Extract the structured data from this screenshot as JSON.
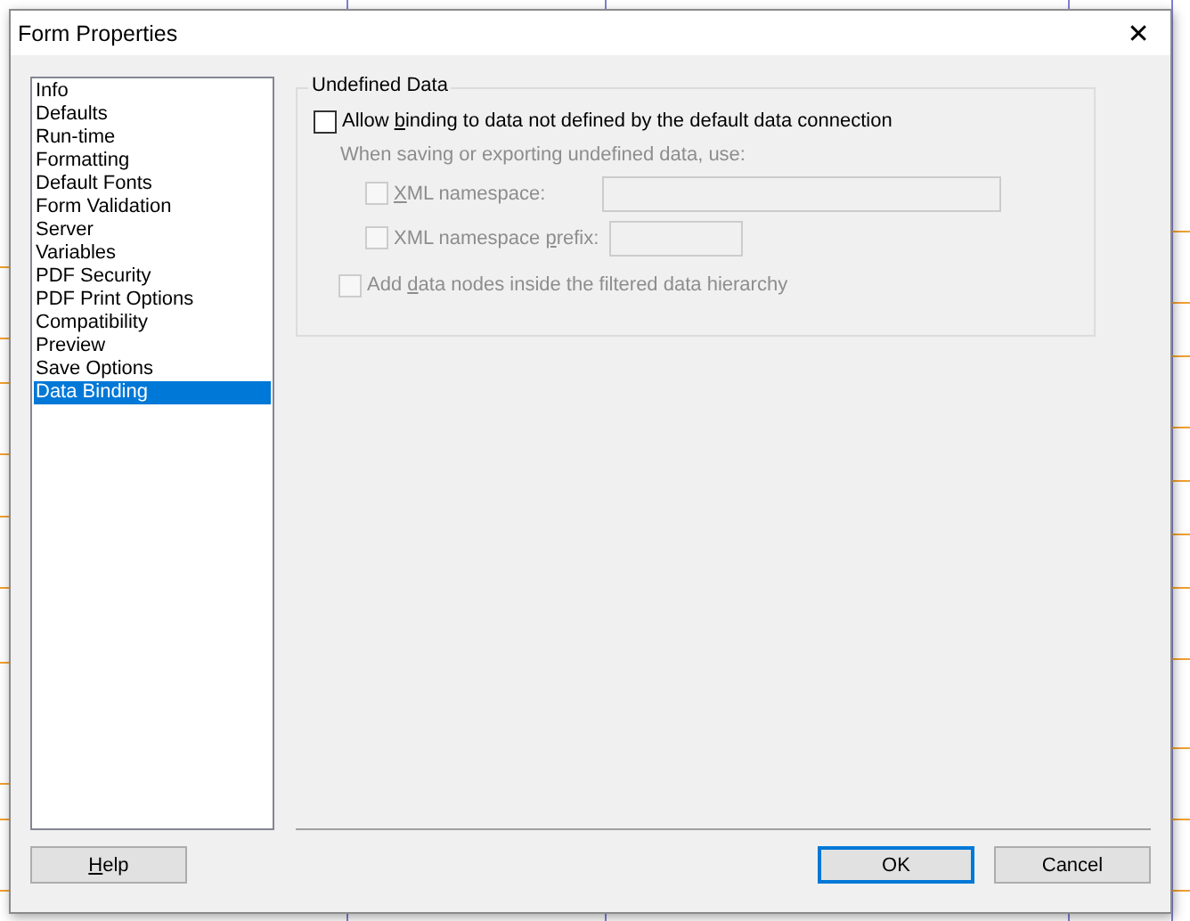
{
  "window": {
    "title": "Form Properties",
    "close": "✕"
  },
  "sidebar": {
    "items": [
      {
        "label": "Info",
        "selected": false
      },
      {
        "label": "Defaults",
        "selected": false
      },
      {
        "label": "Run-time",
        "selected": false
      },
      {
        "label": "Formatting",
        "selected": false
      },
      {
        "label": "Default Fonts",
        "selected": false
      },
      {
        "label": "Form Validation",
        "selected": false
      },
      {
        "label": "Server",
        "selected": false
      },
      {
        "label": "Variables",
        "selected": false
      },
      {
        "label": "PDF Security",
        "selected": false
      },
      {
        "label": "PDF Print Options",
        "selected": false
      },
      {
        "label": "Compatibility",
        "selected": false
      },
      {
        "label": "Preview",
        "selected": false
      },
      {
        "label": "Save Options",
        "selected": false
      },
      {
        "label": "Data Binding",
        "selected": true
      }
    ]
  },
  "group": {
    "title": "Undefined Data",
    "items": [
      {
        "kind": "option",
        "before": "Allow ",
        "key": "b",
        "after": "inding to data not defined by the default data connection",
        "checked": false,
        "disabled": false
      },
      {
        "kind": "note",
        "text": "When saving or exporting undefined data, use:",
        "disabled": true
      },
      {
        "kind": "widefield",
        "key": "X",
        "after": "ML namespace:",
        "checked": false,
        "disabled": true
      },
      {
        "kind": "shortfield",
        "before": "XML namespace ",
        "key": "p",
        "after": "refix:",
        "checked": false,
        "disabled": true
      },
      {
        "kind": "suboption",
        "before": "Add ",
        "key": "d",
        "after": "ata nodes inside the filtered data hierarchy",
        "checked": false,
        "disabled": true
      }
    ]
  },
  "buttons": [
    {
      "key": "H",
      "after": "elp",
      "kind": "help",
      "default": false
    },
    {
      "before": "OK",
      "kind": "ok",
      "default": true
    },
    {
      "before": "Cancel",
      "kind": "cancel",
      "default": false
    }
  ]
}
